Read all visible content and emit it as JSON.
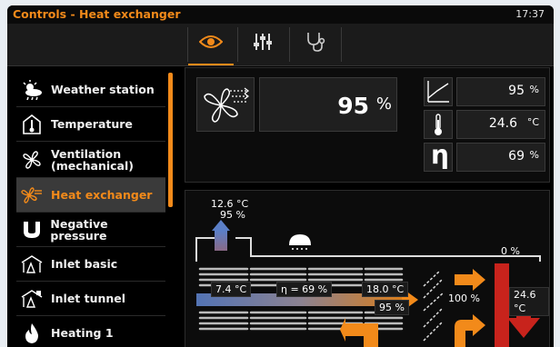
{
  "header": {
    "title": "Controls - Heat exchanger",
    "time": "17:37"
  },
  "tabs": [
    {
      "icon": "eye-icon",
      "selected": true
    },
    {
      "icon": "sliders-icon",
      "selected": false
    },
    {
      "icon": "stethoscope-icon",
      "selected": false
    }
  ],
  "sidebar": {
    "items": [
      {
        "label": "Weather  station",
        "icon": "weather-icon",
        "selected": false
      },
      {
        "label": "Temperature",
        "icon": "thermometer-icon",
        "selected": false
      },
      {
        "label": "Ventilation (mechanical)",
        "label_line1": "Ventilation",
        "label_line2": "(mechanical)",
        "icon": "fan-icon",
        "selected": false
      },
      {
        "label": "Heat exchanger",
        "icon": "heat-exchanger-icon",
        "selected": true
      },
      {
        "label": "Negative pressure",
        "icon": "negative-pressure-icon",
        "selected": false
      },
      {
        "label": "Inlet basic",
        "icon": "inlet-basic-icon",
        "selected": false
      },
      {
        "label": "Inlet tunnel",
        "icon": "inlet-tunnel-icon",
        "selected": false
      },
      {
        "label": "Heating 1",
        "icon": "flame-icon",
        "selected": false
      }
    ]
  },
  "summary": {
    "main": {
      "value": "95",
      "unit": "%"
    },
    "curve": {
      "value": "95",
      "unit": "%"
    },
    "temperature": {
      "value": "24.6",
      "unit": "°C"
    },
    "efficiency": {
      "symbol": "η",
      "value": "69",
      "unit": "%"
    }
  },
  "diagram": {
    "outlet_temp": "12.6 °C",
    "outlet_pct": "95  %",
    "left_temp": "7.4 °C",
    "eta": "η = 69 %",
    "right_temp": "18.0 °C",
    "fan_pct": "95 %",
    "bypass_pct": "100 %",
    "top_pct": "0 %",
    "house_temp": "24.6 °C"
  },
  "colors": {
    "accent": "#f28a1a",
    "cold": "#5b7fc7",
    "hot": "#c8231c"
  }
}
